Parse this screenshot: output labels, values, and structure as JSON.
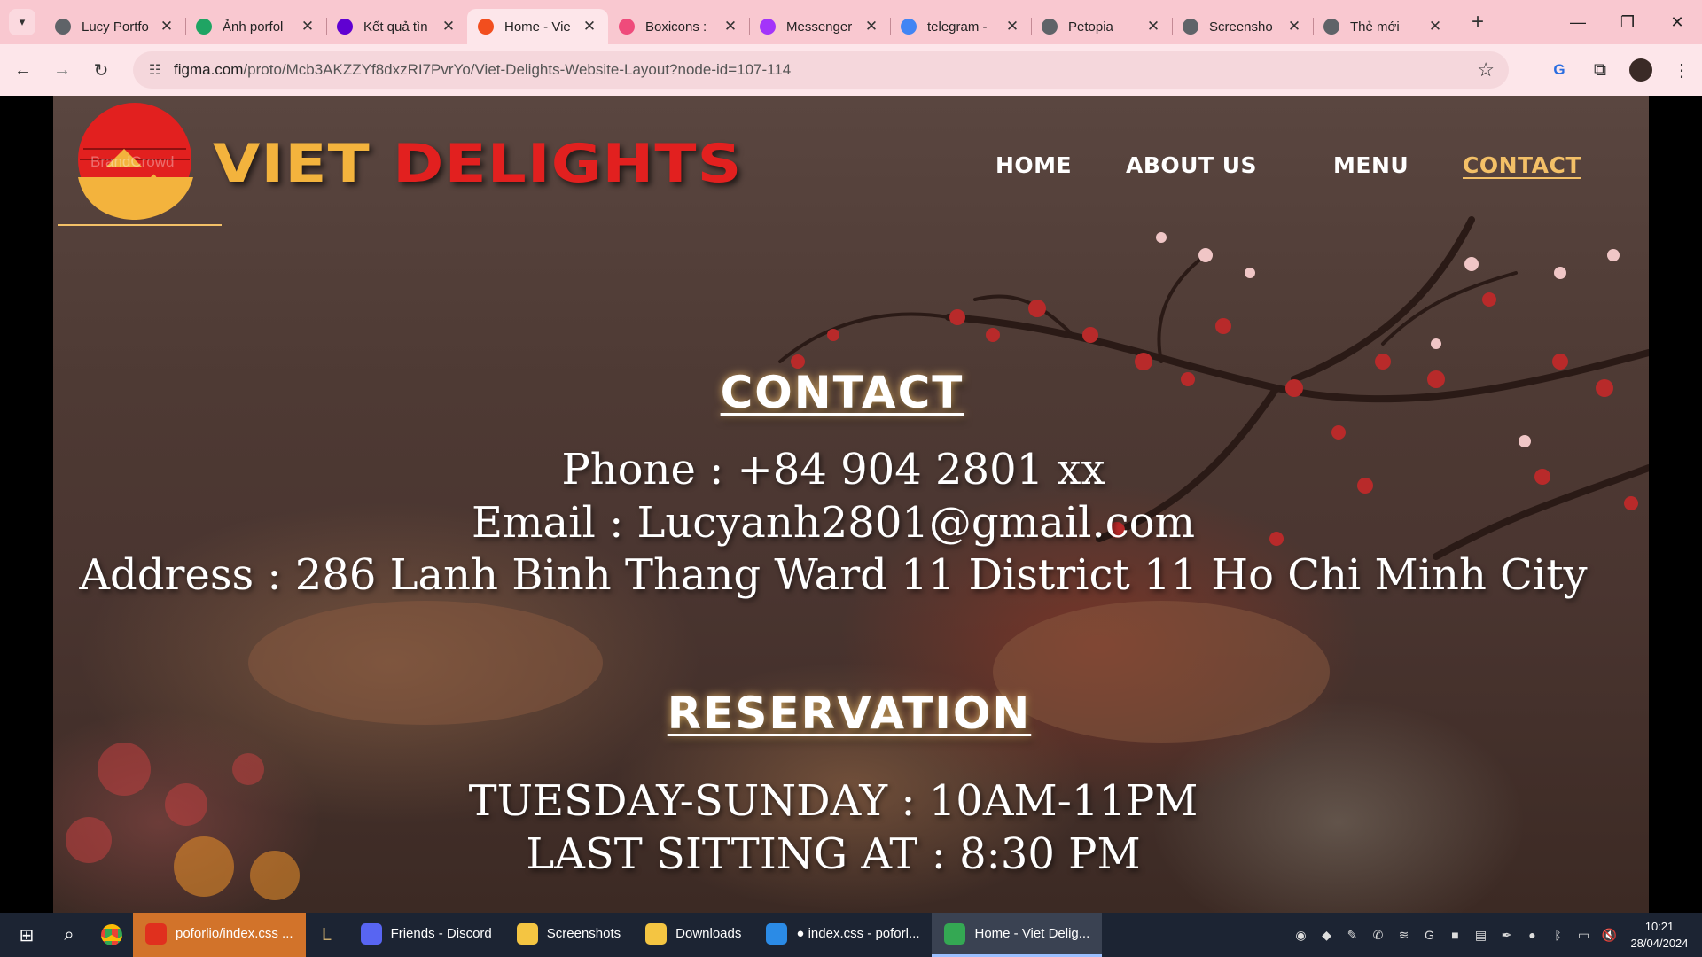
{
  "browser": {
    "tabs": [
      {
        "title": "Lucy Portfo",
        "favicon_color": "#5f6368",
        "active": false
      },
      {
        "title": "Ảnh porfol",
        "favicon_color": "#1fa463",
        "active": false
      },
      {
        "title": "Kết quả tìn",
        "favicon_color": "#6001d2",
        "active": false
      },
      {
        "title": "Home - Vie",
        "favicon_color": "#f24e1e",
        "active": true
      },
      {
        "title": "Boxicons :",
        "favicon_color": "#ef4b7b",
        "active": false
      },
      {
        "title": "Messenger",
        "favicon_color": "#a334fa",
        "active": false
      },
      {
        "title": "telegram -",
        "favicon_color": "#4285f4",
        "active": false
      },
      {
        "title": "Petopia",
        "favicon_color": "#5f6368",
        "active": false
      },
      {
        "title": "Screensho",
        "favicon_color": "#5f6368",
        "active": false
      },
      {
        "title": "Thẻ mới",
        "favicon_color": "#5f6368",
        "active": false
      }
    ],
    "url_host": "figma.com",
    "url_path": "/proto/Mcb3AKZZYf8dxzRI7PvrYo/Viet-Delights-Website-Layout?node-id=107-114"
  },
  "site": {
    "brand_first": "VIET",
    "brand_second": "DELIGHTS",
    "logo_watermark": "BrandCrowd",
    "nav": {
      "home": "HOME",
      "about": "ABOUT US",
      "menu": "MENU",
      "contact": "CONTACT"
    },
    "contact": {
      "heading": "CONTACT",
      "phone": "Phone : +84 904 2801 xx",
      "email": "Email : Lucyanh2801@gmail.com",
      "address": "Address : 286 Lanh Binh Thang  Ward 11 District 11 Ho Chi Minh City"
    },
    "reservation": {
      "heading": "RESERVATION",
      "hours": "TUESDAY-SUNDAY : 10AM-11PM",
      "last_sitting": "LAST SITTING AT : 8:30 PM"
    },
    "colors": {
      "brand_gold": "#f3b33d",
      "brand_red": "#e2201f",
      "nav_active": "#f3c067"
    }
  },
  "taskbar": {
    "apps": [
      {
        "label": "poforlio/index.css ...",
        "icon_color": "#e0301e"
      },
      {
        "label": "Friends - Discord",
        "icon_color": "#5865f2"
      },
      {
        "label": "Screenshots",
        "icon_color": "#f4c542"
      },
      {
        "label": "Downloads",
        "icon_color": "#f4c542"
      },
      {
        "label": "● index.css - poforl...",
        "icon_color": "#2b8be6"
      },
      {
        "label": "Home - Viet Delig...",
        "icon_color": "#34a853"
      }
    ],
    "time": "10:21",
    "date": "28/04/2024"
  }
}
